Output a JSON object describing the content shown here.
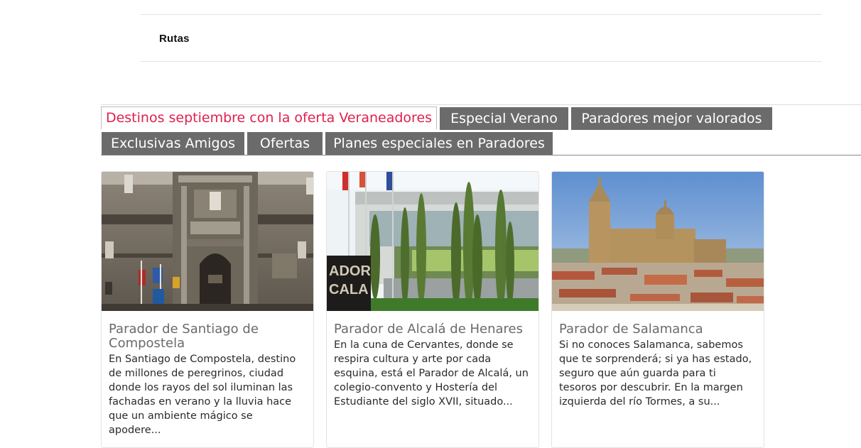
{
  "menu": {
    "item_label": "Rutas"
  },
  "tabs": [
    {
      "label": "Destinos septiembre con la oferta Veraneadores",
      "active": true
    },
    {
      "label": "Especial Verano",
      "active": false
    },
    {
      "label": "Paradores mejor valorados",
      "active": false
    },
    {
      "label": "Exclusivas Amigos",
      "active": false
    },
    {
      "label": "Ofertas",
      "active": false
    },
    {
      "label": "Planes especiales en Paradores",
      "active": false
    }
  ],
  "colors": {
    "active_tab_text": "#e0204f",
    "tab_background": "#6b6b6b",
    "tab_text": "#ffffff",
    "card_title": "#6a6a6a"
  },
  "cards": [
    {
      "title": "Parador de Santiago de Compostela",
      "description": "En Santiago de Compostela, destino de millones de peregrinos, ciudad donde los rayos del sol iluminan las fachadas en verano y la lluvia hace que un ambiente mágico se apodere..."
    },
    {
      "title": "Parador de Alcalá de Henares",
      "description": "En la cuna de Cervantes, donde se respira cultura y arte por cada esquina, está el Parador de Alcalá, un colegio-convento y Hostería del Estudiante del siglo XVII, situado...",
      "photo_sign_text": "ADOR\nCALA"
    },
    {
      "title": "Parador de Salamanca",
      "description": "Si no conoces Salamanca, sabemos que te sorprenderá; si ya has estado, seguro que aún guarda para ti tesoros por descubrir. En la margen izquierda del río Tormes, a su..."
    }
  ]
}
